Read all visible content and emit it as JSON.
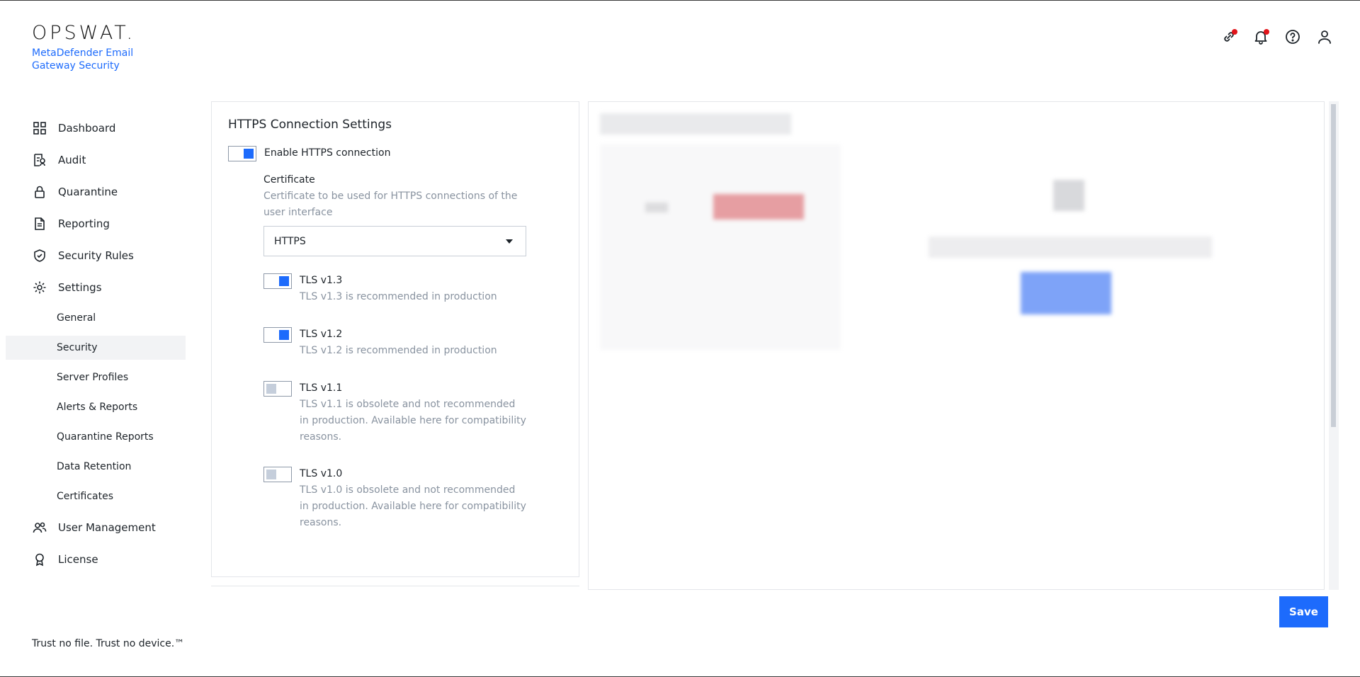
{
  "brand": {
    "logo_text": "OPSWAT.",
    "product_name": "MetaDefender Email Gateway Security",
    "tagline": "Trust no file. Trust no device.™"
  },
  "header_icons": [
    "link-icon",
    "bell-icon",
    "help-icon",
    "user-icon"
  ],
  "sidebar": {
    "items": [
      {
        "label": "Dashboard",
        "icon": "grid-icon"
      },
      {
        "label": "Audit",
        "icon": "audit-icon"
      },
      {
        "label": "Quarantine",
        "icon": "lock-icon"
      },
      {
        "label": "Reporting",
        "icon": "document-icon"
      },
      {
        "label": "Security Rules",
        "icon": "shield-check-icon"
      },
      {
        "label": "Settings",
        "icon": "gear-icon"
      }
    ],
    "settings_sub": [
      {
        "label": "General"
      },
      {
        "label": "Security",
        "active": true
      },
      {
        "label": "Server Profiles"
      },
      {
        "label": "Alerts & Reports"
      },
      {
        "label": "Quarantine Reports"
      },
      {
        "label": "Data Retention"
      },
      {
        "label": "Certificates"
      }
    ],
    "bottom_items": [
      {
        "label": "User Management",
        "icon": "users-icon"
      },
      {
        "label": "License",
        "icon": "award-icon"
      }
    ]
  },
  "https_settings": {
    "title": "HTTPS Connection Settings",
    "enable_label": "Enable HTTPS connection",
    "enable_on": true,
    "certificate_label": "Certificate",
    "certificate_desc": "Certificate to be used for HTTPS connections of the user interface",
    "certificate_value": "HTTPS",
    "tls": [
      {
        "label": "TLS v1.3",
        "desc": "TLS v1.3 is recommended in production",
        "on": true
      },
      {
        "label": "TLS v1.2",
        "desc": "TLS v1.2 is recommended in production",
        "on": true
      },
      {
        "label": "TLS v1.1",
        "desc": "TLS v1.1 is obsolete and not recommended in production. Available here for compatibility reasons.",
        "on": false
      },
      {
        "label": "TLS v1.0",
        "desc": "TLS v1.0 is obsolete and not recommended in production. Available here for compatibility reasons.",
        "on": false
      }
    ]
  },
  "actions": {
    "save_label": "Save"
  },
  "colors": {
    "accent": "#1d6bfc",
    "badge": "#e1141a",
    "muted_text": "#8993a0"
  }
}
